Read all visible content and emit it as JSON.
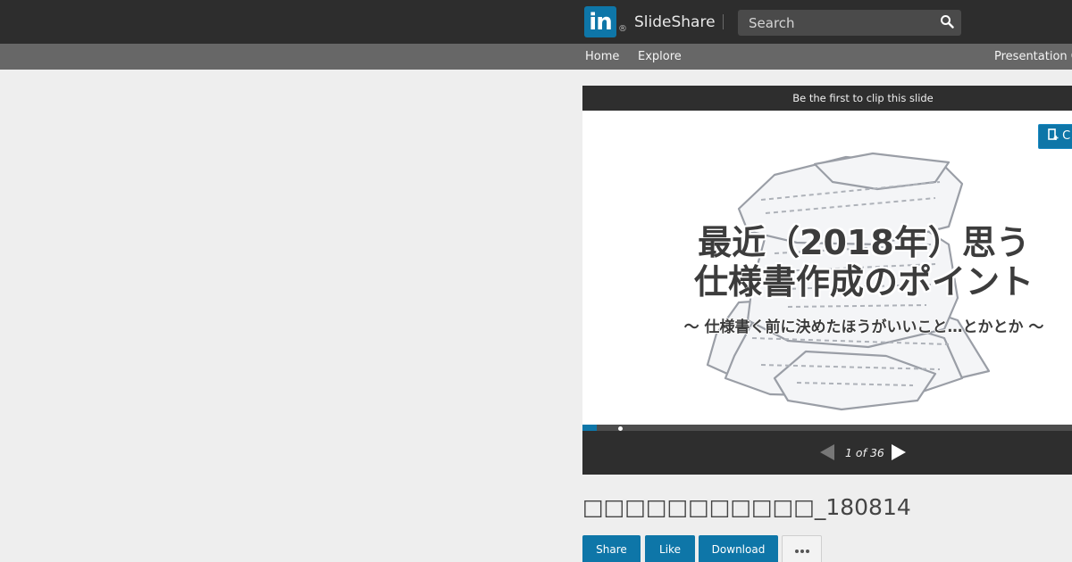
{
  "header": {
    "logo_text": "in",
    "logo_reg": "®",
    "brand": "SlideShare",
    "search_placeholder": "Search"
  },
  "nav": {
    "home": "Home",
    "explore": "Explore",
    "presentation": "Presentation C"
  },
  "player": {
    "clip_banner": "Be the first to clip this slide",
    "clip_button_label": "C",
    "slide_title_line1": "最近（2018年）思う",
    "slide_title_line2": "仕様書作成のポイント",
    "slide_subtitle": "〜 仕様書く前に決めたほうがいいこと…とかとか 〜",
    "page_indicator": "1 of 36",
    "progress": 0.03
  },
  "document": {
    "title": "□□□□□□□□□□□_180814"
  },
  "actions": {
    "share": "Share",
    "like": "Like",
    "download": "Download",
    "more": "..."
  },
  "colors": {
    "accent": "#0e76a8",
    "topbar": "#2d2d2d",
    "navbar": "#676767",
    "page_bg": "#eeeeee"
  }
}
